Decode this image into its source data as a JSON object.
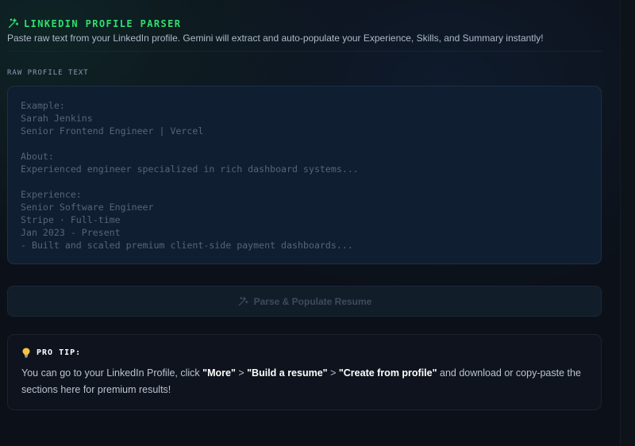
{
  "header": {
    "title": "LINKEDIN PROFILE PARSER",
    "subtitle": "Paste raw text from your LinkedIn profile. Gemini will extract and auto-populate your Experience, Skills, and Summary instantly!"
  },
  "input": {
    "label": "RAW PROFILE TEXT",
    "placeholder": "Example:\nSarah Jenkins\nSenior Frontend Engineer | Vercel\n\nAbout:\nExperienced engineer specialized in rich dashboard systems...\n\nExperience:\nSenior Software Engineer\nStripe · Full-time\nJan 2023 - Present\n- Built and scaled premium client-side payment dashboards..."
  },
  "actions": {
    "parse_label": "Parse & Populate Resume",
    "disabled": true
  },
  "tip": {
    "title": "PRO TIP:",
    "text_prefix": "You can go to your LinkedIn Profile, click ",
    "step1": "\"More\"",
    "sep1": " > ",
    "step2": "\"Build a resume\"",
    "sep2": " > ",
    "step3": "\"Create from profile\"",
    "text_suffix": " and download or copy-paste the sections here for premium results!"
  },
  "colors": {
    "accent": "#2ee06f",
    "tip_bulb": "#f5c542"
  },
  "icons": {
    "title_icon": "sparkles-icon",
    "button_icon": "sparkles-icon",
    "tip_icon": "lightbulb-icon"
  }
}
